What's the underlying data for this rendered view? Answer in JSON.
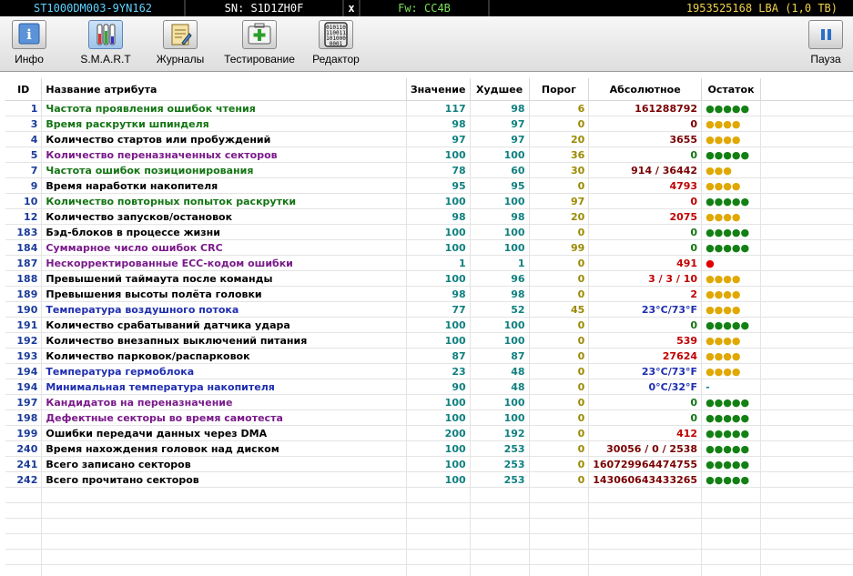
{
  "status_bar": {
    "model": "ST1000DM003-9YN162",
    "serial": "SN: S1D1ZH0F",
    "close": "x",
    "firmware": "Fw: CC4B",
    "capacity": "1953525168 LBA (1,0 TB)"
  },
  "toolbar": {
    "info": "Инфо",
    "smart": "S.M.A.R.T",
    "logs": "Журналы",
    "testing": "Тестирование",
    "editor": "Редактор",
    "pause": "Пауза"
  },
  "table": {
    "headers": {
      "id": "ID",
      "name": "Название атрибута",
      "value": "Значение",
      "worst": "Худшее",
      "threshold": "Порог",
      "absolute": "Абсолютное",
      "remaining": "Остаток"
    },
    "rows": [
      {
        "id": "1",
        "name": "Частота проявления ошибок чтения",
        "value": "117",
        "worst": "98",
        "threshold": "6",
        "absolute": "161288792",
        "remaining": "●●●●●",
        "name_color": "green",
        "abs_color": "dark",
        "rem_color": "green"
      },
      {
        "id": "3",
        "name": "Время раскрутки шпинделя",
        "value": "98",
        "worst": "97",
        "threshold": "0",
        "absolute": "0",
        "remaining": "●●●●",
        "name_color": "green",
        "abs_color": "dark",
        "rem_color": "yellow"
      },
      {
        "id": "4",
        "name": "Количество стартов или пробуждений",
        "value": "97",
        "worst": "97",
        "threshold": "20",
        "absolute": "3655",
        "remaining": "●●●●",
        "name_color": "black",
        "abs_color": "dark",
        "rem_color": "yellow"
      },
      {
        "id": "5",
        "name": "Количество переназначенных секторов",
        "value": "100",
        "worst": "100",
        "threshold": "36",
        "absolute": "0",
        "remaining": "●●●●●",
        "name_color": "purple",
        "abs_color": "green",
        "rem_color": "green"
      },
      {
        "id": "7",
        "name": "Частота ошибок позиционирования",
        "value": "78",
        "worst": "60",
        "threshold": "30",
        "absolute": "914 / 36442",
        "remaining": "●●●",
        "name_color": "green",
        "abs_color": "dark",
        "rem_color": "yellow"
      },
      {
        "id": "9",
        "name": "Время наработки накопителя",
        "value": "95",
        "worst": "95",
        "threshold": "0",
        "absolute": "4793",
        "remaining": "●●●●",
        "name_color": "black",
        "abs_color": "red",
        "rem_color": "yellow"
      },
      {
        "id": "10",
        "name": "Количество повторных попыток раскрутки",
        "value": "100",
        "worst": "100",
        "threshold": "97",
        "absolute": "0",
        "remaining": "●●●●●",
        "name_color": "green",
        "abs_color": "red",
        "rem_color": "green"
      },
      {
        "id": "12",
        "name": "Количество запусков/остановок",
        "value": "98",
        "worst": "98",
        "threshold": "20",
        "absolute": "2075",
        "remaining": "●●●●",
        "name_color": "black",
        "abs_color": "red",
        "rem_color": "yellow"
      },
      {
        "id": "183",
        "name": "Бэд-блоков в процессе жизни",
        "value": "100",
        "worst": "100",
        "threshold": "0",
        "absolute": "0",
        "remaining": "●●●●●",
        "name_color": "black",
        "abs_color": "green",
        "rem_color": "green"
      },
      {
        "id": "184",
        "name": "Суммарное число ошибок CRC",
        "value": "100",
        "worst": "100",
        "threshold": "99",
        "absolute": "0",
        "remaining": "●●●●●",
        "name_color": "purple",
        "abs_color": "green",
        "rem_color": "green"
      },
      {
        "id": "187",
        "name": "Нескорректированные ЕСС-кодом ошибки",
        "value": "1",
        "worst": "1",
        "threshold": "0",
        "absolute": "491",
        "remaining": "●",
        "name_color": "purple",
        "abs_color": "red",
        "rem_color": "red"
      },
      {
        "id": "188",
        "name": "Превышений таймаута после команды",
        "value": "100",
        "worst": "96",
        "threshold": "0",
        "absolute": "3 / 3 / 10",
        "remaining": "●●●●",
        "name_color": "black",
        "abs_color": "red",
        "rem_color": "yellow"
      },
      {
        "id": "189",
        "name": "Превышения высоты полёта головки",
        "value": "98",
        "worst": "98",
        "threshold": "0",
        "absolute": "2",
        "remaining": "●●●●",
        "name_color": "black",
        "abs_color": "red",
        "rem_color": "yellow"
      },
      {
        "id": "190",
        "name": "Температура воздушного потока",
        "value": "77",
        "worst": "52",
        "threshold": "45",
        "absolute": "23°C/73°F",
        "remaining": "●●●●",
        "name_color": "blue",
        "abs_color": "blue",
        "rem_color": "yellow"
      },
      {
        "id": "191",
        "name": "Количество срабатываний датчика удара",
        "value": "100",
        "worst": "100",
        "threshold": "0",
        "absolute": "0",
        "remaining": "●●●●●",
        "name_color": "black",
        "abs_color": "green",
        "rem_color": "green"
      },
      {
        "id": "192",
        "name": "Количество внезапных выключений питания",
        "value": "100",
        "worst": "100",
        "threshold": "0",
        "absolute": "539",
        "remaining": "●●●●",
        "name_color": "black",
        "abs_color": "red",
        "rem_color": "yellow"
      },
      {
        "id": "193",
        "name": "Количество парковок/распарковок",
        "value": "87",
        "worst": "87",
        "threshold": "0",
        "absolute": "27624",
        "remaining": "●●●●",
        "name_color": "black",
        "abs_color": "red",
        "rem_color": "yellow"
      },
      {
        "id": "194",
        "name": "Температура гермоблока",
        "value": "23",
        "worst": "48",
        "threshold": "0",
        "absolute": "23°C/73°F",
        "remaining": "●●●●",
        "name_color": "blue",
        "abs_color": "blue",
        "rem_color": "yellow"
      },
      {
        "id": "194",
        "name": "Минимальная температура накопителя",
        "value": "90",
        "worst": "48",
        "threshold": "0",
        "absolute": "0°C/32°F",
        "remaining": "-",
        "name_color": "blue",
        "abs_color": "blue",
        "rem_color": "teal"
      },
      {
        "id": "197",
        "name": "Кандидатов на переназначение",
        "value": "100",
        "worst": "100",
        "threshold": "0",
        "absolute": "0",
        "remaining": "●●●●●",
        "name_color": "purple",
        "abs_color": "green",
        "rem_color": "green"
      },
      {
        "id": "198",
        "name": "Дефектные секторы во время самотеста",
        "value": "100",
        "worst": "100",
        "threshold": "0",
        "absolute": "0",
        "remaining": "●●●●●",
        "name_color": "purple",
        "abs_color": "green",
        "rem_color": "green"
      },
      {
        "id": "199",
        "name": "Ошибки передачи данных через DMA",
        "value": "200",
        "worst": "192",
        "threshold": "0",
        "absolute": "412",
        "remaining": "●●●●●",
        "name_color": "black",
        "abs_color": "red",
        "rem_color": "green"
      },
      {
        "id": "240",
        "name": "Время нахождения головок над диском",
        "value": "100",
        "worst": "253",
        "threshold": "0",
        "absolute": "30056 / 0 / 2538",
        "remaining": "●●●●●",
        "name_color": "black",
        "abs_color": "dark",
        "rem_color": "green"
      },
      {
        "id": "241",
        "name": "Всего записано секторов",
        "value": "100",
        "worst": "253",
        "threshold": "0",
        "absolute": "160729964474755",
        "remaining": "●●●●●",
        "name_color": "black",
        "abs_color": "dark",
        "rem_color": "green"
      },
      {
        "id": "242",
        "name": "Всего прочитано секторов",
        "value": "100",
        "worst": "253",
        "threshold": "0",
        "absolute": "143060643433265",
        "remaining": "●●●●●",
        "name_color": "black",
        "abs_color": "dark",
        "rem_color": "green"
      }
    ]
  }
}
